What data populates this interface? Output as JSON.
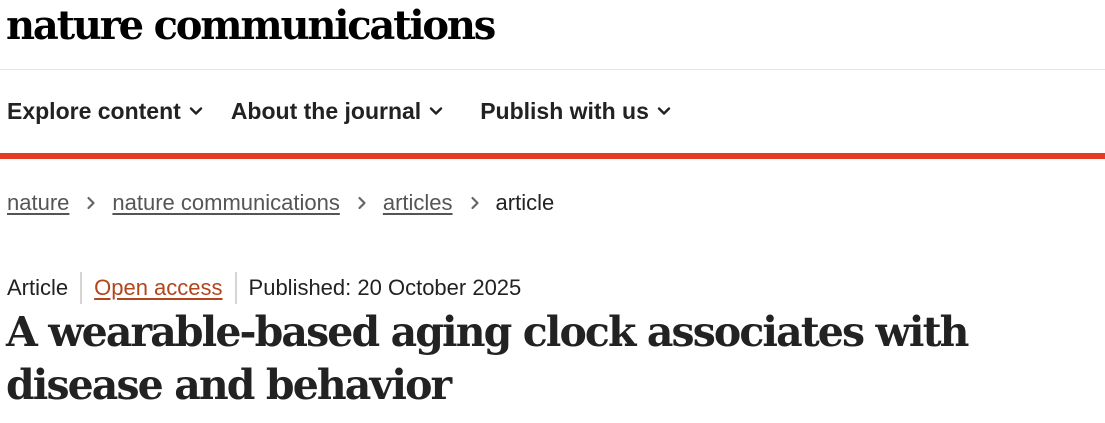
{
  "site": {
    "logo_text": "nature communications"
  },
  "nav": {
    "items": [
      {
        "label": "Explore content",
        "icon": "chevron-down-icon"
      },
      {
        "label": "About the journal",
        "icon": "chevron-down-icon"
      },
      {
        "label": "Publish with us",
        "icon": "chevron-down-icon"
      }
    ]
  },
  "breadcrumb": {
    "items": [
      {
        "label": "nature"
      },
      {
        "label": "nature communications"
      },
      {
        "label": "articles"
      },
      {
        "label": "article"
      }
    ],
    "separator_icon": "chevron-right-icon"
  },
  "article": {
    "type": "Article",
    "access": "Open access",
    "published": "Published: 20 October 2025",
    "title": "A wearable-based aging clock associates with disease and behavior"
  },
  "colors": {
    "accent_bar": "#e43a26",
    "open_access": "#b3451d",
    "text": "#222222",
    "link": "#555555"
  }
}
